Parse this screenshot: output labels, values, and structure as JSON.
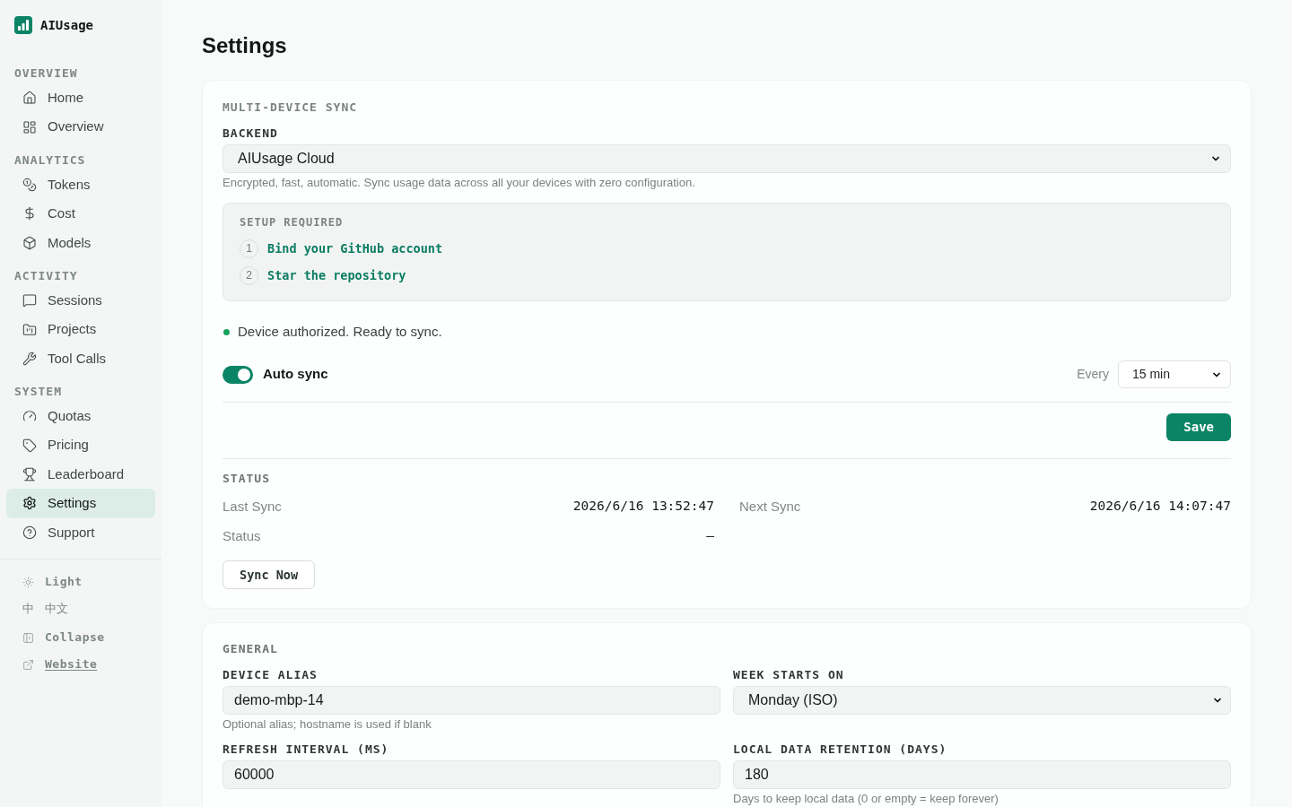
{
  "app": {
    "name": "AIUsage"
  },
  "sidebar": {
    "sections": [
      {
        "label": "OVERVIEW",
        "items": [
          {
            "label": "Home",
            "selected": false
          },
          {
            "label": "Overview",
            "selected": false
          }
        ]
      },
      {
        "label": "ANALYTICS",
        "items": [
          {
            "label": "Tokens",
            "selected": false
          },
          {
            "label": "Cost",
            "selected": false
          },
          {
            "label": "Models",
            "selected": false
          }
        ]
      },
      {
        "label": "ACTIVITY",
        "items": [
          {
            "label": "Sessions",
            "selected": false
          },
          {
            "label": "Projects",
            "selected": false
          },
          {
            "label": "Tool Calls",
            "selected": false
          }
        ]
      },
      {
        "label": "SYSTEM",
        "items": [
          {
            "label": "Quotas",
            "selected": false
          },
          {
            "label": "Pricing",
            "selected": false
          },
          {
            "label": "Leaderboard",
            "selected": false
          },
          {
            "label": "Settings",
            "selected": true
          },
          {
            "label": "Support",
            "selected": false
          }
        ]
      }
    ],
    "footer": [
      {
        "kind": "theme",
        "label": "Light"
      },
      {
        "kind": "language",
        "glyph": "中",
        "label": "中文"
      },
      {
        "kind": "collapse",
        "label": "Collapse"
      },
      {
        "kind": "link",
        "label": "Website"
      }
    ]
  },
  "page": {
    "title": "Settings"
  },
  "sync": {
    "title": "MULTI-DEVICE SYNC",
    "backend": {
      "label": "BACKEND",
      "value": "AIUsage Cloud",
      "hint": "Encrypted, fast, automatic. Sync usage data across all your devices with zero configuration."
    },
    "setup": {
      "title": "SETUP REQUIRED",
      "steps": [
        {
          "number": "1",
          "label": "Bind your GitHub account"
        },
        {
          "number": "2",
          "label": "Star the repository"
        }
      ]
    },
    "device_status": "Device authorized. Ready to sync.",
    "auto_sync": {
      "label": "Auto sync",
      "on": true,
      "interval_label": "Every",
      "interval": "15 min"
    },
    "save_button": "Save",
    "status": {
      "title": "STATUS",
      "rows": [
        {
          "label": "Last Sync",
          "value": "2026/6/16 13:52:47"
        },
        {
          "label": "Next Sync",
          "value": "2026/6/16 14:07:47"
        },
        {
          "label": "Status",
          "value": "—"
        }
      ],
      "sync_button": "Sync Now"
    }
  },
  "general": {
    "title": "GENERAL",
    "fields": [
      {
        "kind": "text",
        "label": "DEVICE ALIAS",
        "value": "demo-mbp-14",
        "hint": "Optional alias; hostname is used if blank"
      },
      {
        "kind": "select",
        "label": "WEEK STARTS ON",
        "value": "Monday (ISO)"
      },
      {
        "kind": "text",
        "label": "REFRESH INTERVAL (MS)",
        "value": "60000"
      },
      {
        "kind": "text",
        "label": "LOCAL DATA RETENTION (DAYS)",
        "value": "180",
        "hint": "Days to keep local data (0 or empty = keep forever)"
      }
    ]
  }
}
